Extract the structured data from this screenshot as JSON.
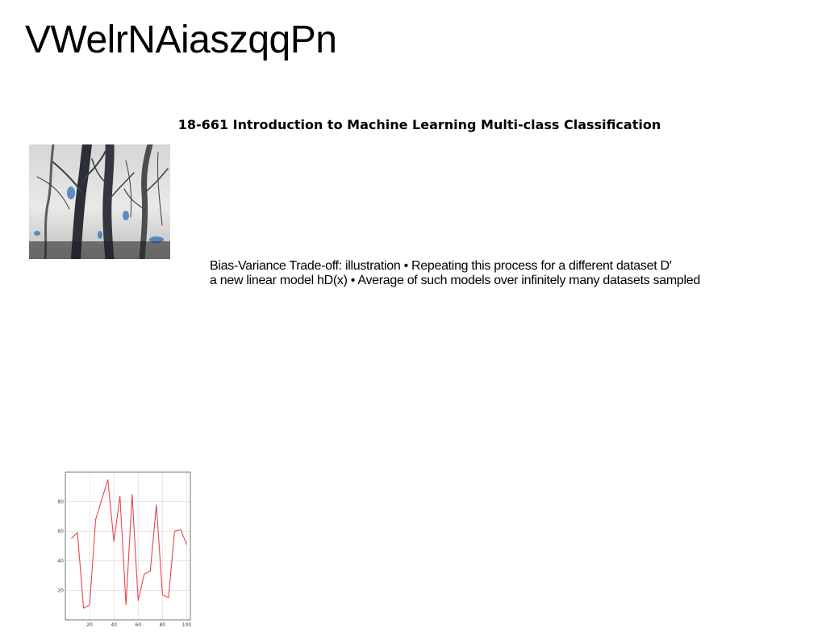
{
  "title": "VWelrNAiaszqqPn",
  "heading": "18-661 Introduction to Machine Learning Multi-class Classification",
  "body_lines": [
    "Bias-Variance Trade-off: illustration • Repeating this process for a different dataset D′",
    "a new linear model hD(x) • Average of such models over infinitely many datasets sampled"
  ],
  "photo": {
    "icon": "forest-trees-photo"
  },
  "chart_data": {
    "type": "line",
    "x": [
      5,
      10,
      15,
      20,
      25,
      35,
      40,
      45,
      50,
      55,
      60,
      65,
      70,
      75,
      80,
      85,
      90,
      95,
      100
    ],
    "values": [
      55,
      59,
      8,
      10,
      68,
      95,
      53,
      84,
      10,
      85,
      13,
      31,
      33,
      78,
      17,
      15,
      60,
      61,
      51
    ],
    "xlim": [
      0,
      103
    ],
    "ylim": [
      0,
      100
    ],
    "xticks": [
      20,
      40,
      60,
      80,
      100
    ],
    "yticks": [
      20,
      40,
      60,
      80
    ],
    "grid": true,
    "color": "#e8474c",
    "title": "",
    "xlabel": "",
    "ylabel": ""
  }
}
